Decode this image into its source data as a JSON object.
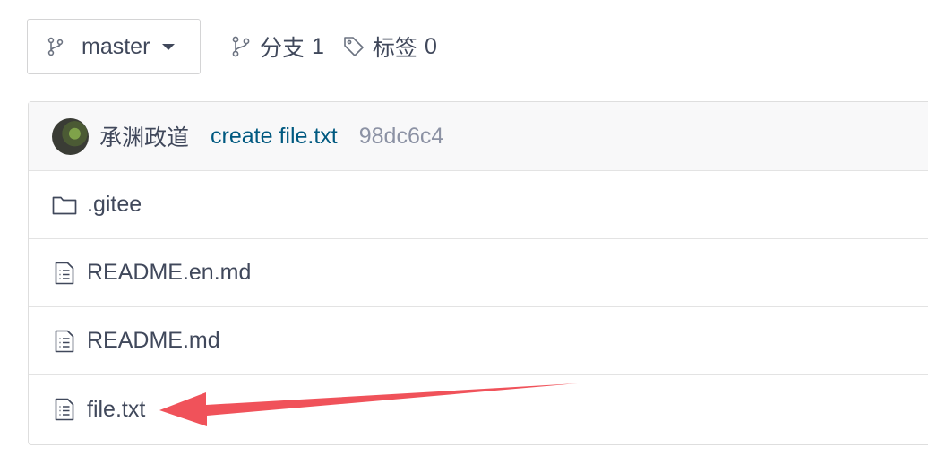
{
  "branch_bar": {
    "branch_name": "master",
    "branches_label": "分支",
    "branches_count": "1",
    "tags_label": "标签",
    "tags_count": "0"
  },
  "commit": {
    "author": "承渊政道",
    "message": "create file.txt",
    "hash": "98dc6c4"
  },
  "files": [
    {
      "name": ".gitee",
      "type": "folder",
      "icon": "folder-icon"
    },
    {
      "name": "README.en.md",
      "type": "file",
      "icon": "file-text-icon"
    },
    {
      "name": "README.md",
      "type": "file",
      "icon": "file-text-icon"
    },
    {
      "name": "file.txt",
      "type": "file",
      "icon": "file-text-icon"
    }
  ],
  "colors": {
    "text": "#40485b",
    "commit_link": "#005980",
    "hash": "#8c92a4",
    "annotation_arrow": "#f0525a"
  }
}
